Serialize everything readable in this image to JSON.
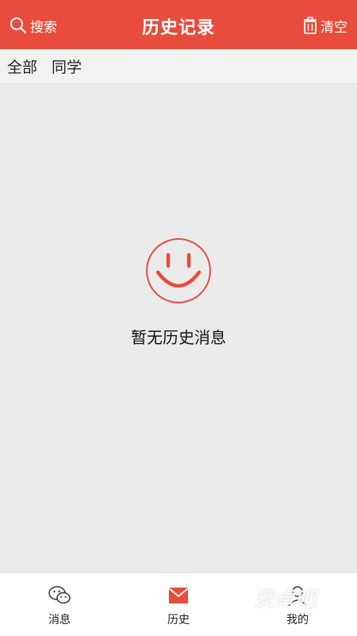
{
  "header": {
    "search_label": "搜索",
    "title": "历史记录",
    "clear_label": "清空"
  },
  "filters": {
    "all": "全部",
    "classmates": "同学"
  },
  "empty_state": {
    "message": "暂无历史消息"
  },
  "tabbar": {
    "messages": "消息",
    "history": "历史",
    "mine": "我的"
  },
  "watermark": "安卓吧",
  "colors": {
    "accent": "#e74c3c",
    "background": "#eaeaea",
    "tabbar_bg": "#ffffff"
  },
  "icons": {
    "search": "search-icon",
    "clear": "trash-icon",
    "empty": "smile-icon",
    "messages": "chat-bubbles-icon",
    "history": "envelope-icon",
    "mine": "user-icon"
  }
}
